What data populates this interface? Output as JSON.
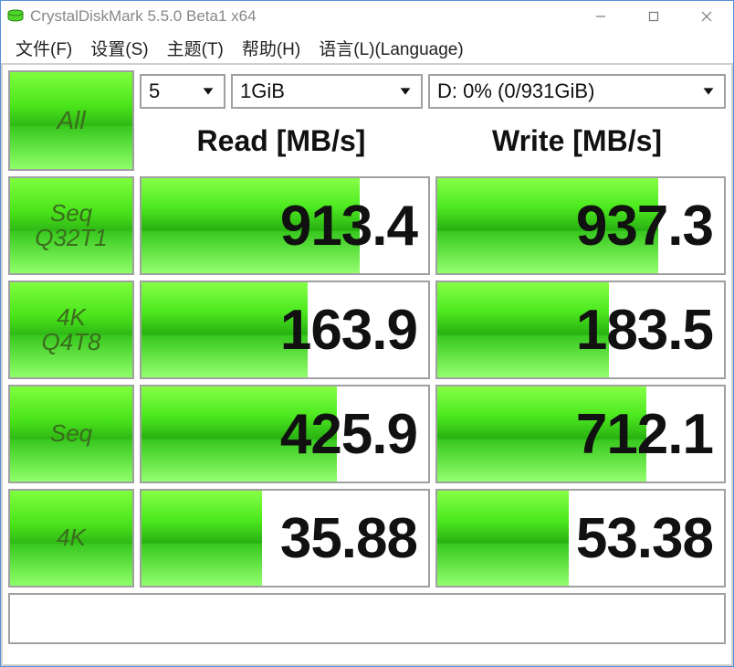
{
  "window": {
    "title": "CrystalDiskMark 5.5.0 Beta1 x64"
  },
  "menu": {
    "file": "文件(F)",
    "settings": "设置(S)",
    "theme": "主题(T)",
    "help": "帮助(H)",
    "language": "语言(L)(Language)"
  },
  "controls": {
    "all": "All",
    "loops": "5",
    "size": "1GiB",
    "drive": "D: 0% (0/931GiB)"
  },
  "headers": {
    "read": "Read [MB/s]",
    "write": "Write [MB/s]"
  },
  "tests": [
    {
      "label1": "Seq",
      "label2": "Q32T1",
      "read": "913.4",
      "read_pct": 76,
      "write": "937.3",
      "write_pct": 77
    },
    {
      "label1": "4K",
      "label2": "Q4T8",
      "read": "163.9",
      "read_pct": 58,
      "write": "183.5",
      "write_pct": 60
    },
    {
      "label1": "Seq",
      "label2": "",
      "read": "425.9",
      "read_pct": 68,
      "write": "712.1",
      "write_pct": 73
    },
    {
      "label1": "4K",
      "label2": "",
      "read": "35.88",
      "read_pct": 42,
      "write": "53.38",
      "write_pct": 46
    }
  ],
  "status": ""
}
